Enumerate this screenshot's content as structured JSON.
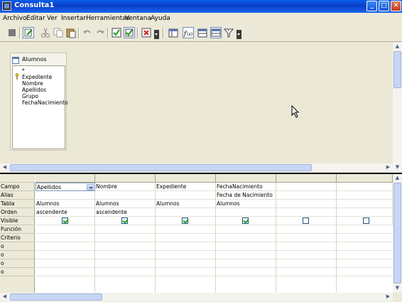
{
  "window": {
    "title": "Consulta1",
    "controls": {
      "minimize": "_",
      "maximize": "□",
      "close": "✕"
    }
  },
  "menu": [
    "Archivo",
    "Editar",
    "Ver",
    "Insertar",
    "Herramientas",
    "Ventana",
    "Ayuda"
  ],
  "toolbar": {
    "buttons": [
      "design-view-icon",
      "edit-icon",
      "cut-icon",
      "copy-icon",
      "paste-icon",
      "undo-icon",
      "redo-icon",
      "run-query-icon",
      "clear-query-icon",
      "delete-table-icon",
      "add-table-icon",
      "functions-icon",
      "table-name-icon",
      "alias-icon",
      "distinct-icon"
    ]
  },
  "design": {
    "table": {
      "title": "Alumnos",
      "fields": [
        "*",
        "Expediente",
        "Nombre",
        "Apellidos",
        "Grupo",
        "FechaNacimiento"
      ],
      "primary_key": "Expediente"
    }
  },
  "grid": {
    "row_labels": [
      "Campo",
      "Alias",
      "Tabla",
      "Orden",
      "Visible",
      "Función",
      "Criterio",
      "o",
      "o",
      "o",
      "o"
    ],
    "columns": [
      {
        "campo": "Apellidos",
        "alias": "",
        "tabla": "Alumnos",
        "orden": "ascendente",
        "visible": true
      },
      {
        "campo": "Nombre",
        "alias": "",
        "tabla": "Alumnos",
        "orden": "ascendente",
        "visible": true
      },
      {
        "campo": "Expediente",
        "alias": "",
        "tabla": "Alumnos",
        "orden": "",
        "visible": true
      },
      {
        "campo": "FechaNacimiento",
        "alias": "Fecha de Nacimiento",
        "tabla": "Alumnos",
        "orden": "",
        "visible": true
      },
      {
        "campo": "",
        "alias": "",
        "tabla": "",
        "orden": "",
        "visible": false
      },
      {
        "campo": "",
        "alias": "",
        "tabla": "",
        "orden": "",
        "visible": false
      }
    ]
  }
}
